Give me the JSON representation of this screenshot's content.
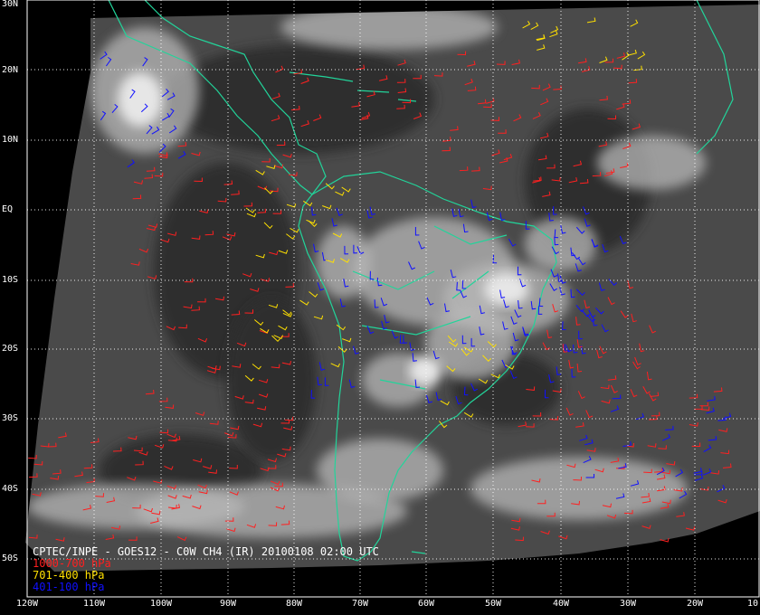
{
  "map": {
    "source_label": "CPTEC/INPE - GOES12 - C0W CH4 (IR) 20100108 02:00 UTC",
    "legend": [
      {
        "label": "1000-700 hPa",
        "color": "#ff2020"
      },
      {
        "label": "701-400 hPa",
        "color": "#ffe000"
      },
      {
        "label": "401-100 hPa",
        "color": "#1010ff"
      }
    ],
    "lat_labels": [
      "30N",
      "20N",
      "10N",
      "EQ",
      "10S",
      "20S",
      "30S",
      "40S",
      "50S"
    ],
    "lon_labels": [
      "120W",
      "110W",
      "100W",
      "90W",
      "80W",
      "70W",
      "60W",
      "50W",
      "40W",
      "30W",
      "20W",
      "10"
    ],
    "colors": {
      "background": "#000000",
      "coastline": "#22d49a",
      "grid": "#ffffff",
      "cloud_bright": "#e6e6e6",
      "cloud_dark": "#3a3a3a"
    }
  }
}
